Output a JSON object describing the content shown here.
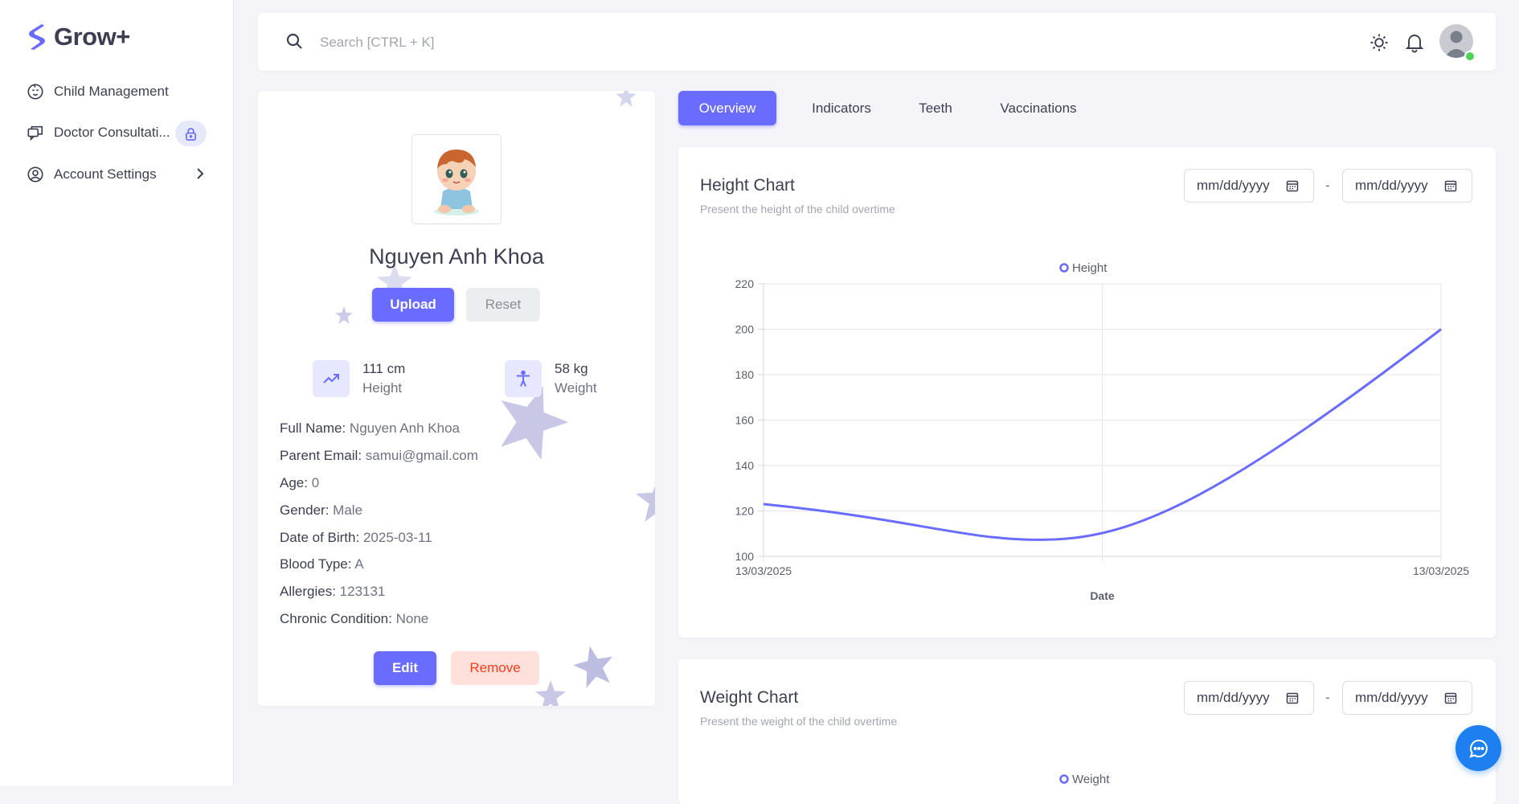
{
  "app": {
    "name": "Grow+"
  },
  "sidebar": {
    "items": [
      {
        "label": "Child Management",
        "icon": "baby-face-icon"
      },
      {
        "label": "Doctor Consultati...",
        "icon": "chat-bubbles-icon",
        "badge_icon": "lock-icon"
      },
      {
        "label": "Account Settings",
        "icon": "user-circle-icon",
        "trailing_icon": "chevron-right-icon"
      }
    ]
  },
  "topbar": {
    "search_placeholder": "Search [CTRL + K]",
    "icons": [
      "search-icon",
      "sun-icon",
      "bell-icon",
      "avatar"
    ],
    "online_status_color": "#4fd15a"
  },
  "profile": {
    "name": "Nguyen Anh Khoa",
    "upload_label": "Upload",
    "reset_label": "Reset",
    "height_value": "111 cm",
    "height_label": "Height",
    "weight_value": "58 kg",
    "weight_label": "Weight",
    "fields": [
      {
        "label": "Full Name:",
        "value": "Nguyen Anh Khoa"
      },
      {
        "label": "Parent Email:",
        "value": "samui@gmail.com"
      },
      {
        "label": "Age:",
        "value": "0"
      },
      {
        "label": "Gender:",
        "value": "Male"
      },
      {
        "label": "Date of Birth:",
        "value": "2025-03-11"
      },
      {
        "label": "Blood Type:",
        "value": "A"
      },
      {
        "label": "Allergies:",
        "value": "123131"
      },
      {
        "label": "Chronic Condition:",
        "value": "None"
      }
    ],
    "edit_label": "Edit",
    "remove_label": "Remove"
  },
  "tabs": [
    {
      "label": "Overview",
      "active": true
    },
    {
      "label": "Indicators",
      "active": false
    },
    {
      "label": "Teeth",
      "active": false
    },
    {
      "label": "Vaccinations",
      "active": false
    }
  ],
  "height_chart": {
    "title": "Height Chart",
    "subtitle": "Present the height of the child overtime",
    "date_from_placeholder": "mm/dd/yyyy",
    "date_to_placeholder": "mm/dd/yyyy",
    "date_separator": "-"
  },
  "weight_chart": {
    "title": "Weight Chart",
    "subtitle": "Present the weight of the child overtime",
    "date_from_placeholder": "mm/dd/yyyy",
    "date_to_placeholder": "mm/dd/yyyy",
    "date_separator": "-",
    "legend": "Weight"
  },
  "colors": {
    "primary": "#696cff",
    "chat_button": "#1e7ff0",
    "danger": "#ff3e1d"
  },
  "chart_data": {
    "type": "line",
    "title": "",
    "x": [
      "13/03/2025",
      "13/03/2025"
    ],
    "xlabel": "Date",
    "ylabel": "",
    "ylim": [
      100,
      220
    ],
    "yticks": [
      100,
      120,
      140,
      160,
      180,
      200,
      220
    ],
    "series": [
      {
        "name": "Height",
        "values": [
          123,
          200
        ],
        "color": "#696cff"
      }
    ],
    "legend_position": "top-center",
    "grid": true
  }
}
